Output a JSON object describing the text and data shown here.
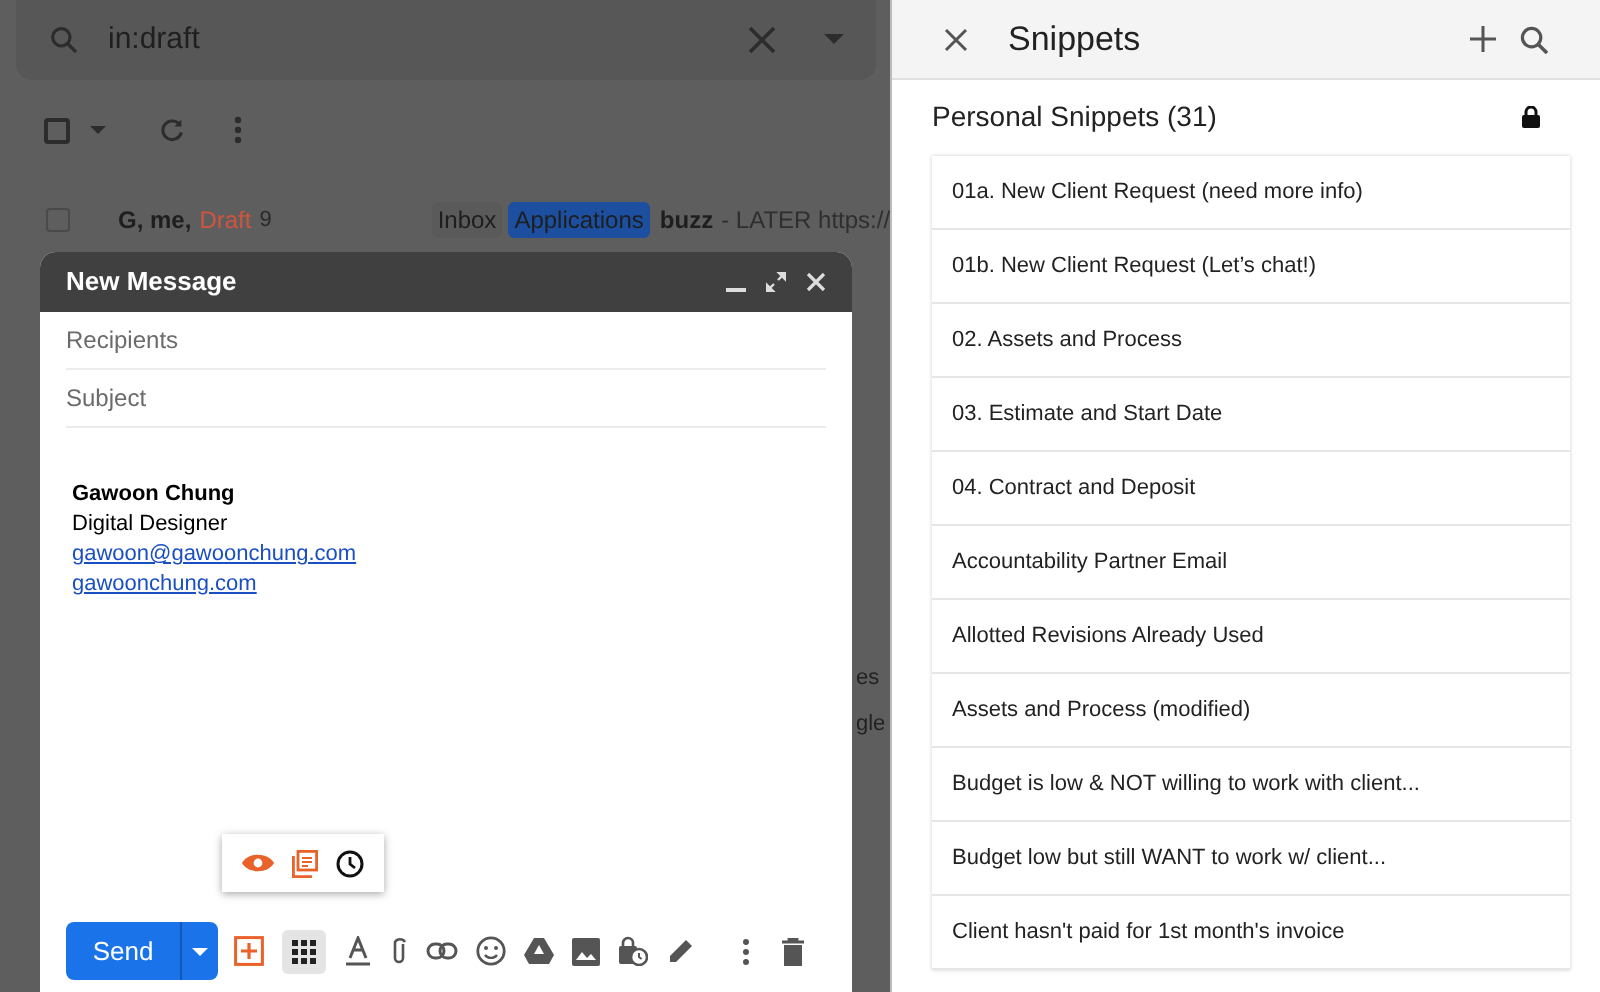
{
  "mail": {
    "search": {
      "value": "in:draft"
    },
    "row": {
      "senders": "G, me,",
      "draft": "Draft",
      "count": "9",
      "labels": [
        {
          "text": "Inbox",
          "color": "#5a5a5a"
        },
        {
          "text": "Applications",
          "color": "#1c4fa0"
        }
      ],
      "subject": "buzz",
      "snippet": "- LATER https://"
    },
    "select_all": {
      "checked": false
    },
    "row_checked": false,
    "fragments": [
      "es",
      "gle"
    ]
  },
  "compose": {
    "title": "New Message",
    "recipients": {
      "placeholder": "Recipients"
    },
    "subject": {
      "placeholder": "Subject"
    },
    "signature": {
      "name": "Gawoon Chung",
      "role": "Digital Designer",
      "email": "gawoon@gawoonchung.com",
      "website": "gawoonchung.com"
    },
    "send": "Send"
  },
  "snippets": {
    "title": "Snippets",
    "section": "Personal Snippets (31)",
    "items": [
      "01a. New Client Request (need more info)",
      "01b. New Client Request (Let’s chat!)",
      "02. Assets and Process",
      "03. Estimate and Start Date",
      "04. Contract and Deposit",
      "Accountability Partner Email",
      "Allotted Revisions Already Used",
      "Assets and Process (modified)",
      "Budget is low & NOT willing to work with client...",
      "Budget low but still WANT to work w/ client...",
      "Client hasn't paid for 1st month's invoice"
    ]
  }
}
